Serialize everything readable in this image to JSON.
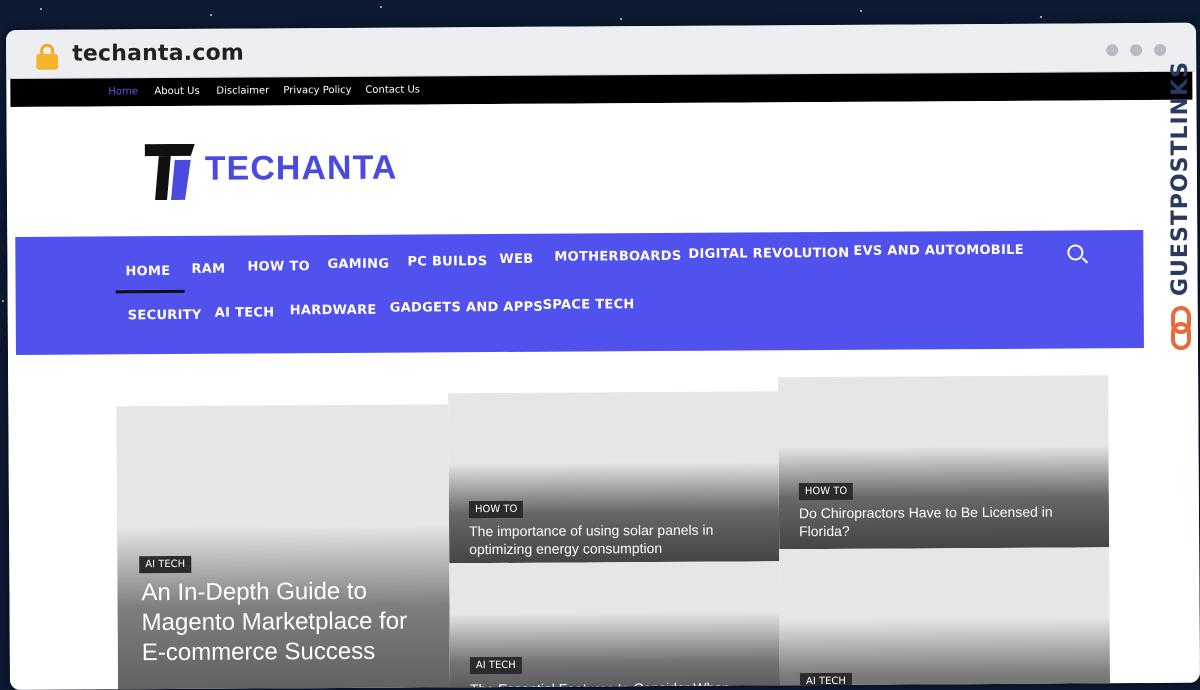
{
  "browser": {
    "url": "techanta.com"
  },
  "topbar": {
    "links": [
      "Home",
      "About Us",
      "Disclaimer",
      "Privacy Policy",
      "Contact Us"
    ]
  },
  "site": {
    "logo_text": "TECHANTA",
    "nav": {
      "row1": [
        "HOME",
        "RAM",
        "HOW TO",
        "GAMING",
        "PC BUILDS",
        "WEB",
        "MOTHERBOARDS",
        "DIGITAL REVOLUTION",
        "EVS AND AUTOMOBILE"
      ],
      "row2": [
        "SECURITY",
        "AI TECH",
        "HARDWARE",
        "GADGETS AND APPS",
        "SPACE TECH"
      ]
    }
  },
  "articles": [
    {
      "tag": "AI TECH",
      "title": "An In-Depth Guide to Magento Marketplace for E-commerce Success"
    },
    {
      "tag": "HOW TO",
      "title": "The importance of using solar panels in optimizing energy consumption"
    },
    {
      "tag": "HOW TO",
      "title": "Do Chiropractors Have to Be Licensed in Florida?"
    },
    {
      "tag": "AI TECH",
      "title": "The Essential Features to Consider When"
    },
    {
      "tag": "AI TECH",
      "title": ""
    }
  ],
  "watermark": {
    "text": "GUESTPOSTLINKS"
  },
  "colors": {
    "accent": "#5151ee",
    "topbar_bg": "#000000",
    "active_link": "#5a5aef"
  }
}
